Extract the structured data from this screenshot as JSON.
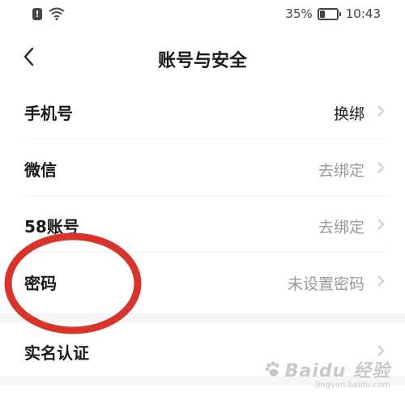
{
  "status_bar": {
    "battery_percent": "35%",
    "battery_level": 0.35,
    "time": "10:43"
  },
  "header": {
    "title": "账号与安全"
  },
  "settings": {
    "rows": [
      {
        "label": "手机号",
        "value": "换绑",
        "value_style": "dark"
      },
      {
        "label": "微信",
        "value": "去绑定",
        "value_style": "muted"
      },
      {
        "label": "58账号",
        "value": "去绑定",
        "value_style": "muted"
      },
      {
        "label": "密码",
        "value": "未设置密码",
        "value_style": "muted"
      }
    ],
    "section2": [
      {
        "label": "实名认证",
        "value": ""
      }
    ]
  },
  "annotation": {
    "color": "#d9342b"
  },
  "watermark": {
    "brand": "Baidu 经验",
    "url": "jingyan.baidu.com"
  }
}
